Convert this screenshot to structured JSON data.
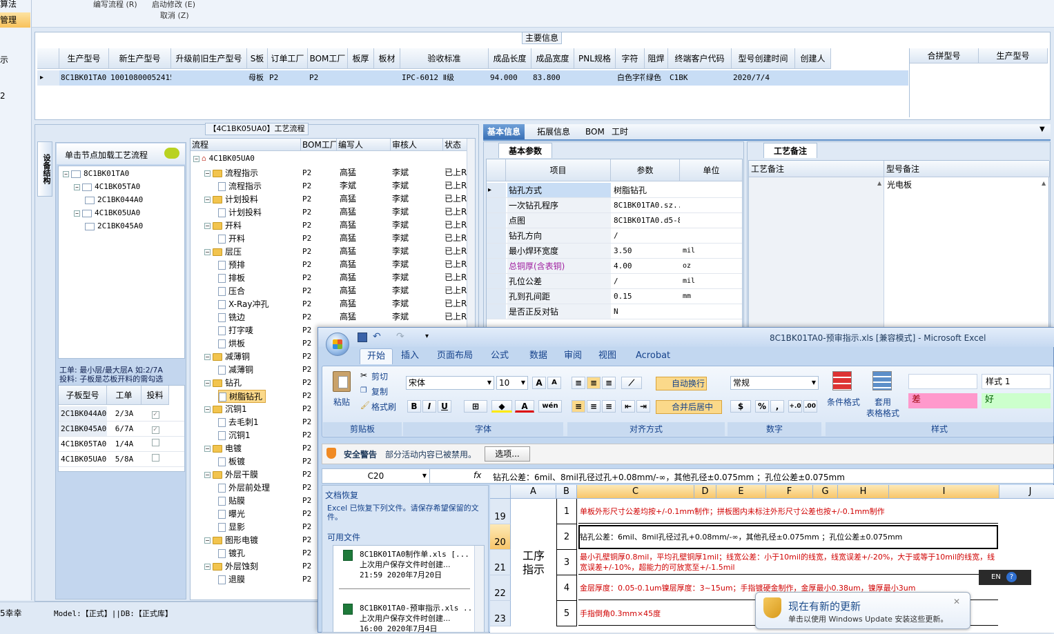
{
  "app_menu": {
    "item1": "编写流程 (R)",
    "item2": "启动修改 (E)",
    "item3": "取消 (Z)"
  },
  "left_nav": {
    "item_top": "算法",
    "item_active": "管理",
    "item_a": "示",
    "item_b": "2"
  },
  "main_info": {
    "title": "主要信息",
    "columns": [
      "生产型号",
      "新生产型号",
      "升级前旧生产型号",
      "S板",
      "订单工厂",
      "BOM工厂",
      "板厚",
      "板材",
      "验收标准",
      "成品长度",
      "成品宽度",
      "PNL规格",
      "字符",
      "阻焊",
      "终端客户代码",
      "型号创建时间",
      "创建人"
    ],
    "row": [
      "8C1BK01TA0",
      "10010800052415",
      "",
      "母板",
      "P2",
      "P2",
      "",
      "",
      "IPC-6012 Ⅱ级",
      "94.000",
      "83.800",
      "",
      "白色字符",
      "绿色",
      "C1BK",
      "2020/7/4",
      ""
    ],
    "merge_columns": [
      "合拼型号",
      "生产型号"
    ]
  },
  "flow_panel": {
    "title": "【4C1BK05UA0】工艺流程",
    "side_tab": "设备结构",
    "hint": "单击节点加载工艺流程",
    "tree": [
      "8C1BK01TA0",
      "4C1BK05TA0",
      "2C1BK044A0",
      "4C1BK05UA0",
      "2C1BK045A0"
    ],
    "note1": "工单: 最小层/最大层A 如:2/7A",
    "note2": "投料: 子板是芯板开料的需勾选",
    "sub_columns": [
      "子板型号",
      "工单",
      "投料"
    ],
    "sub_rows": [
      {
        "model": "2C1BK044A0",
        "order": "2/3A",
        "feed": true
      },
      {
        "model": "2C1BK045A0",
        "order": "6/7A",
        "feed": true
      },
      {
        "model": "4C1BK05TA0",
        "order": "1/4A",
        "feed": false
      },
      {
        "model": "4C1BK05UA0",
        "order": "5/8A",
        "feed": false
      }
    ]
  },
  "process": {
    "columns": [
      "流程",
      "BOM工厂",
      "编写人",
      "审核人",
      "状态"
    ],
    "root": "4C1BK05UA0",
    "rows": [
      {
        "name": "流程指示",
        "level": 1,
        "folder": true,
        "bom": "P2",
        "writer": "高猛",
        "auditor": "李斌",
        "status": "已上R"
      },
      {
        "name": "流程指示",
        "level": 2,
        "folder": false,
        "bom": "P2",
        "writer": "李斌",
        "auditor": "李斌",
        "status": "已上R"
      },
      {
        "name": "计划投料",
        "level": 1,
        "folder": true,
        "bom": "P2",
        "writer": "高猛",
        "auditor": "李斌",
        "status": "已上R"
      },
      {
        "name": "计划投料",
        "level": 2,
        "folder": false,
        "bom": "P2",
        "writer": "高猛",
        "auditor": "李斌",
        "status": "已上R"
      },
      {
        "name": "开料",
        "level": 1,
        "folder": true,
        "bom": "P2",
        "writer": "高猛",
        "auditor": "李斌",
        "status": "已上R"
      },
      {
        "name": "开料",
        "level": 2,
        "folder": false,
        "bom": "P2",
        "writer": "高猛",
        "auditor": "李斌",
        "status": "已上R"
      },
      {
        "name": "层压",
        "level": 1,
        "folder": true,
        "bom": "P2",
        "writer": "高猛",
        "auditor": "李斌",
        "status": "已上R"
      },
      {
        "name": "预排",
        "level": 2,
        "folder": false,
        "bom": "P2",
        "writer": "高猛",
        "auditor": "李斌",
        "status": "已上R"
      },
      {
        "name": "排板",
        "level": 2,
        "folder": false,
        "bom": "P2",
        "writer": "高猛",
        "auditor": "李斌",
        "status": "已上R"
      },
      {
        "name": "压合",
        "level": 2,
        "folder": false,
        "bom": "P2",
        "writer": "高猛",
        "auditor": "李斌",
        "status": "已上R"
      },
      {
        "name": "X-Ray冲孔",
        "level": 2,
        "folder": false,
        "bom": "P2",
        "writer": "高猛",
        "auditor": "李斌",
        "status": "已上R"
      },
      {
        "name": "铣边",
        "level": 2,
        "folder": false,
        "bom": "P2",
        "writer": "高猛",
        "auditor": "李斌",
        "status": "已上R"
      },
      {
        "name": "打字唛",
        "level": 2,
        "folder": false,
        "bom": "P2",
        "writer": "",
        "auditor": "",
        "status": ""
      },
      {
        "name": "烘板",
        "level": 2,
        "folder": false,
        "bom": "P2",
        "writer": "",
        "auditor": "",
        "status": ""
      },
      {
        "name": "减薄铜",
        "level": 1,
        "folder": true,
        "bom": "P2",
        "writer": "",
        "auditor": "",
        "status": ""
      },
      {
        "name": "减薄铜",
        "level": 2,
        "folder": false,
        "bom": "P2",
        "writer": "",
        "auditor": "",
        "status": ""
      },
      {
        "name": "钻孔",
        "level": 1,
        "folder": true,
        "bom": "P2",
        "writer": "",
        "auditor": "",
        "status": ""
      },
      {
        "name": "树脂钻孔",
        "level": 2,
        "folder": false,
        "bom": "P2",
        "writer": "",
        "auditor": "",
        "status": "",
        "selected": true
      },
      {
        "name": "沉铜1",
        "level": 1,
        "folder": true,
        "bom": "P2",
        "writer": "",
        "auditor": "",
        "status": ""
      },
      {
        "name": "去毛刺1",
        "level": 2,
        "folder": false,
        "bom": "P2",
        "writer": "",
        "auditor": "",
        "status": ""
      },
      {
        "name": "沉铜1",
        "level": 2,
        "folder": false,
        "bom": "P2",
        "writer": "",
        "auditor": "",
        "status": ""
      },
      {
        "name": "电镀",
        "level": 1,
        "folder": true,
        "bom": "P2",
        "writer": "",
        "auditor": "",
        "status": ""
      },
      {
        "name": "板镀",
        "level": 2,
        "folder": false,
        "bom": "P2",
        "writer": "",
        "auditor": "",
        "status": ""
      },
      {
        "name": "外层干膜",
        "level": 1,
        "folder": true,
        "bom": "P2",
        "writer": "",
        "auditor": "",
        "status": ""
      },
      {
        "name": "外层前处理",
        "level": 2,
        "folder": false,
        "bom": "P2",
        "writer": "",
        "auditor": "",
        "status": ""
      },
      {
        "name": "贴膜",
        "level": 2,
        "folder": false,
        "bom": "P2",
        "writer": "",
        "auditor": "",
        "status": ""
      },
      {
        "name": "曝光",
        "level": 2,
        "folder": false,
        "bom": "P2",
        "writer": "",
        "auditor": "",
        "status": ""
      },
      {
        "name": "显影",
        "level": 2,
        "folder": false,
        "bom": "P2",
        "writer": "",
        "auditor": "",
        "status": ""
      },
      {
        "name": "图形电镀",
        "level": 1,
        "folder": true,
        "bom": "P2",
        "writer": "",
        "auditor": "",
        "status": ""
      },
      {
        "name": "镀孔",
        "level": 2,
        "folder": false,
        "bom": "P2",
        "writer": "",
        "auditor": "",
        "status": ""
      },
      {
        "name": "外层蚀刻",
        "level": 1,
        "folder": true,
        "bom": "P2",
        "writer": "",
        "auditor": "",
        "status": ""
      },
      {
        "name": "退膜",
        "level": 2,
        "folder": false,
        "bom": "P2",
        "writer": "",
        "auditor": "",
        "status": ""
      }
    ]
  },
  "detail": {
    "tabs": [
      "基本信息",
      "拓展信息",
      "BOM",
      "工时"
    ],
    "params_tab": "基本参数",
    "remark_tab": "工艺备注",
    "columns": [
      "项目",
      "参数",
      "单位"
    ],
    "rows": [
      {
        "item": "钻孔方式",
        "value": "树脂钻孔",
        "unit": ""
      },
      {
        "item": "一次钻孔程序",
        "value": "8C1BK01TA0.sz...",
        "unit": ""
      },
      {
        "item": "点图",
        "value": "8C1BK01TA0.d5-8",
        "unit": ""
      },
      {
        "item": "钻孔方向",
        "value": "/",
        "unit": ""
      },
      {
        "item": "最小焊环宽度",
        "value": "3.50",
        "unit": "mil"
      },
      {
        "item": "总铜厚(含表铜)",
        "value": "4.00",
        "unit": "oz",
        "highlight": true
      },
      {
        "item": "孔位公差",
        "value": "/",
        "unit": "mil"
      },
      {
        "item": "孔到孔间距",
        "value": "0.15",
        "unit": "mm"
      },
      {
        "item": "是否正反对钻",
        "value": "N",
        "unit": ""
      }
    ],
    "remark_cols": [
      "工艺备注",
      "型号备注"
    ],
    "model_remark": "光电板"
  },
  "status_bar": {
    "user": "5幸幸",
    "model": "Model:【正式】||DB:【正式库】"
  },
  "excel": {
    "title": "8C1BK01TA0-预审指示.xls  [兼容模式] - Microsoft Excel",
    "ribbon_tabs": [
      "开始",
      "插入",
      "页面布局",
      "公式",
      "数据",
      "审阅",
      "视图",
      "Acrobat"
    ],
    "clipboard": {
      "paste": "粘贴",
      "cut": "剪切",
      "copy": "复制",
      "format": "格式刷",
      "group": "剪贴板"
    },
    "font": {
      "name": "宋体",
      "size": "10",
      "group": "字体"
    },
    "align": {
      "wrap": "自动换行",
      "merge": "合并后居中",
      "group": "对齐方式"
    },
    "number": {
      "format": "常规",
      "group": "数字"
    },
    "styles": {
      "cond": "条件格式",
      "table1": "套用",
      "table2": "表格格式",
      "style1": "样式 1",
      "bad": "差",
      "good": "好",
      "group": "样式"
    },
    "security": {
      "label": "安全警告",
      "text": "部分活动内容已被禁用。",
      "button": "选项..."
    },
    "name_box": "C20",
    "formula": "钻孔公差：6mil、8mil孔径过孔+0.08mm/-∞，其他孔径±0.075mm ；孔位公差±0.075mm",
    "recovery": {
      "title": "文档恢复",
      "desc": "Excel 已恢复下列文件。请保存希望保留的文件。",
      "available": "可用文件",
      "files": [
        {
          "name": "8C1BK01TA0制作单.xls  [...",
          "note": "上次用户保存文件时创建...",
          "time": "21:59 2020年7月20日"
        },
        {
          "name": "8C1BK01TA0-预审指示.xls ...",
          "note": "上次用户保存文件时创建...",
          "time": "16:00 2020年7月4日"
        }
      ]
    },
    "cols": [
      "A",
      "B",
      "C",
      "D",
      "E",
      "F",
      "G",
      "H",
      "I",
      "J"
    ],
    "rows": [
      "19",
      "20",
      "21",
      "22",
      "23"
    ],
    "section": "工序指示",
    "items": [
      {
        "num": "1",
        "text": "单板外形尺寸公差均按+/-0.1mm制作；拼板图内未标注外形尺寸公差也按+/-0.1mm制作",
        "color": "#d00000"
      },
      {
        "num": "2",
        "text": "钻孔公差：6mil、8mil孔径过孔+0.08mm/-∞，其他孔径±0.075mm ；孔位公差±0.075mm",
        "color": "#000000"
      },
      {
        "num": "3",
        "text": "最小孔壁铜厚0.8mil，平均孔壁铜厚1mil；线宽公差：小于10mil的线宽，线宽误差+/-20%，大于或等于10mil的线宽，线宽误差+/-10%，超能力的可放宽至+/-1.5mil",
        "color": "#d00000"
      },
      {
        "num": "4",
        "text": "金层厚度：0.05-0.1um镍层厚度：3~15um；手指镀硬金制作，金厚最小0.38um，镍厚最小3um",
        "color": "#d00000"
      },
      {
        "num": "5",
        "text": "手指倒角0.3mm×45度",
        "color": "#d00000"
      }
    ]
  },
  "tray": {
    "lang": "EN",
    "update_title": "现在有新的更新",
    "update_text": "单击以使用 Windows Update 安装这些更新。"
  }
}
